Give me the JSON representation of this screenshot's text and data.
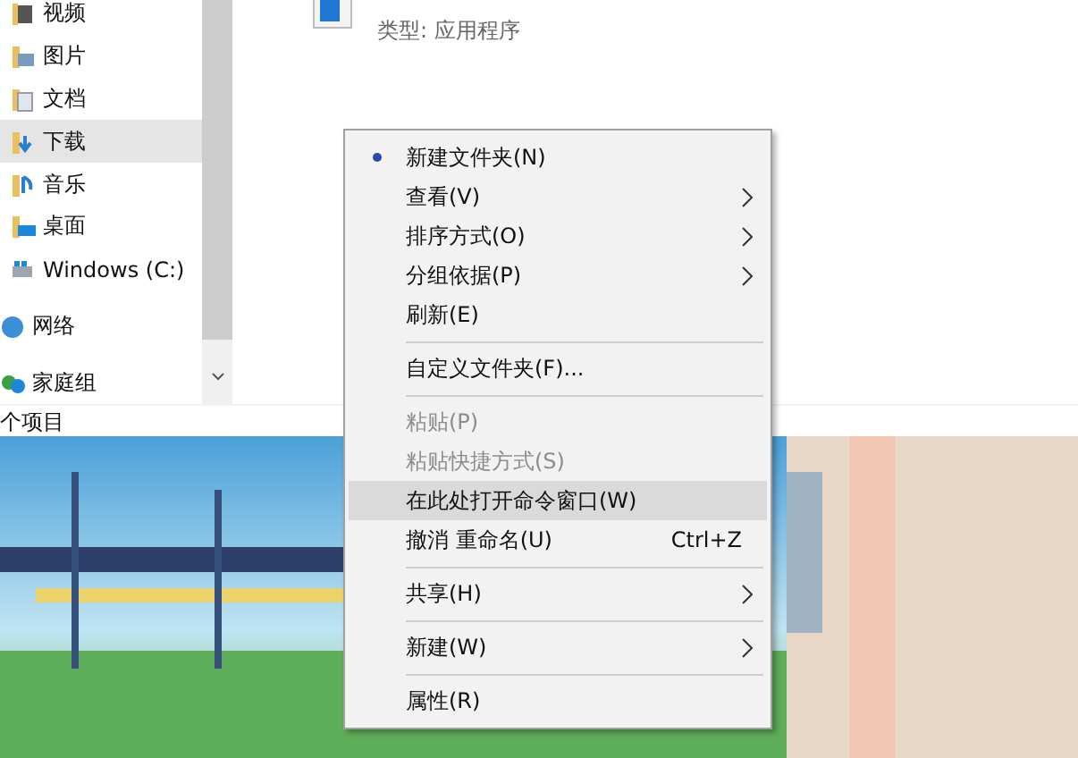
{
  "nav": {
    "items": [
      {
        "label": "视频",
        "selected": false
      },
      {
        "label": "图片",
        "selected": false
      },
      {
        "label": "文档",
        "selected": false
      },
      {
        "label": "下载",
        "selected": true
      },
      {
        "label": "音乐",
        "selected": false
      },
      {
        "label": "桌面",
        "selected": false
      },
      {
        "label": "Windows (C:)",
        "selected": false
      },
      {
        "label": "网络",
        "selected": false
      },
      {
        "label": "家庭组",
        "selected": false
      }
    ]
  },
  "file": {
    "type_label": "类型: 应用程序"
  },
  "status_bar": {
    "text": "个项目"
  },
  "context_menu": {
    "items": [
      {
        "kind": "item",
        "label": "新建文件夹(N)",
        "bullet": true,
        "disabled": false,
        "selected": false,
        "submenu": false
      },
      {
        "kind": "item",
        "label": "查看(V)",
        "bullet": false,
        "disabled": false,
        "selected": false,
        "submenu": true
      },
      {
        "kind": "item",
        "label": "排序方式(O)",
        "bullet": false,
        "disabled": false,
        "selected": false,
        "submenu": true
      },
      {
        "kind": "item",
        "label": "分组依据(P)",
        "bullet": false,
        "disabled": false,
        "selected": false,
        "submenu": true
      },
      {
        "kind": "item",
        "label": "刷新(E)",
        "bullet": false,
        "disabled": false,
        "selected": false,
        "submenu": false
      },
      {
        "kind": "separator"
      },
      {
        "kind": "item",
        "label": "自定义文件夹(F)...",
        "bullet": false,
        "disabled": false,
        "selected": false,
        "submenu": false
      },
      {
        "kind": "separator"
      },
      {
        "kind": "item",
        "label": "粘贴(P)",
        "bullet": false,
        "disabled": true,
        "selected": false,
        "submenu": false
      },
      {
        "kind": "item",
        "label": "粘贴快捷方式(S)",
        "bullet": false,
        "disabled": true,
        "selected": false,
        "submenu": false
      },
      {
        "kind": "item",
        "label": "在此处打开命令窗口(W)",
        "bullet": false,
        "disabled": false,
        "selected": true,
        "submenu": false
      },
      {
        "kind": "item",
        "label": "撤消 重命名(U)",
        "shortcut": "Ctrl+Z",
        "bullet": false,
        "disabled": false,
        "selected": false,
        "submenu": false
      },
      {
        "kind": "separator"
      },
      {
        "kind": "item",
        "label": "共享(H)",
        "bullet": false,
        "disabled": false,
        "selected": false,
        "submenu": true
      },
      {
        "kind": "separator"
      },
      {
        "kind": "item",
        "label": "新建(W)",
        "bullet": false,
        "disabled": false,
        "selected": false,
        "submenu": true
      },
      {
        "kind": "separator"
      },
      {
        "kind": "item",
        "label": "属性(R)",
        "bullet": false,
        "disabled": false,
        "selected": false,
        "submenu": false
      }
    ]
  }
}
